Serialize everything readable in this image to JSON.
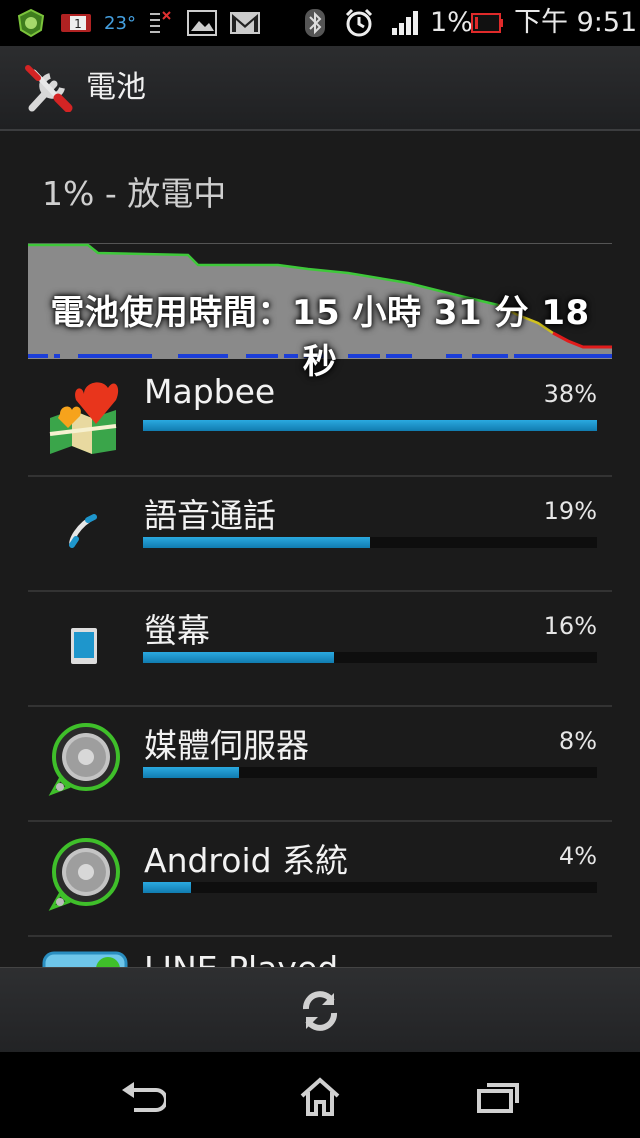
{
  "status_bar": {
    "temperature": "23°",
    "battery_percent": "1%",
    "time": "下午 9:51",
    "notification_count": "1",
    "icons": [
      "security-icon",
      "notification-badge-icon",
      "temperature-icon",
      "network-switch-icon",
      "gallery-icon",
      "gmail-icon",
      "bluetooth-icon",
      "alarm-icon",
      "signal-icon",
      "battery-low-icon"
    ]
  },
  "action_bar": {
    "title": "電池",
    "icon": "tools-icon"
  },
  "battery": {
    "status": "1% - 放電中",
    "usage_time": "電池使用時間：15 小時 31 分 18 秒",
    "level": 0.01
  },
  "usage_list": [
    {
      "name": "Mapbee",
      "percent": "38%",
      "value": 38,
      "icon": "mapbee-icon"
    },
    {
      "name": "語音通話",
      "percent": "19%",
      "value": 19,
      "icon": "phone-call-icon"
    },
    {
      "name": "螢幕",
      "percent": "16%",
      "value": 16,
      "icon": "screen-icon"
    },
    {
      "name": "媒體伺服器",
      "percent": "8%",
      "value": 8,
      "icon": "media-server-icon"
    },
    {
      "name": "Android 系統",
      "percent": "4%",
      "value": 4,
      "icon": "android-system-icon"
    },
    {
      "name": "LINE Played",
      "percent": "",
      "value": 0,
      "icon": "line-app-icon"
    }
  ],
  "refresh_icon": "refresh-icon",
  "nav_bar": {
    "icons": [
      "back-icon",
      "home-icon",
      "recent-apps-icon"
    ]
  },
  "colors": {
    "bar_fill": "#1e96cc",
    "graph_green": "#3ec83a",
    "graph_red": "#e01b1b",
    "graph_yellow": "#d2c21e",
    "graph_blue": "#1c3ed8"
  }
}
